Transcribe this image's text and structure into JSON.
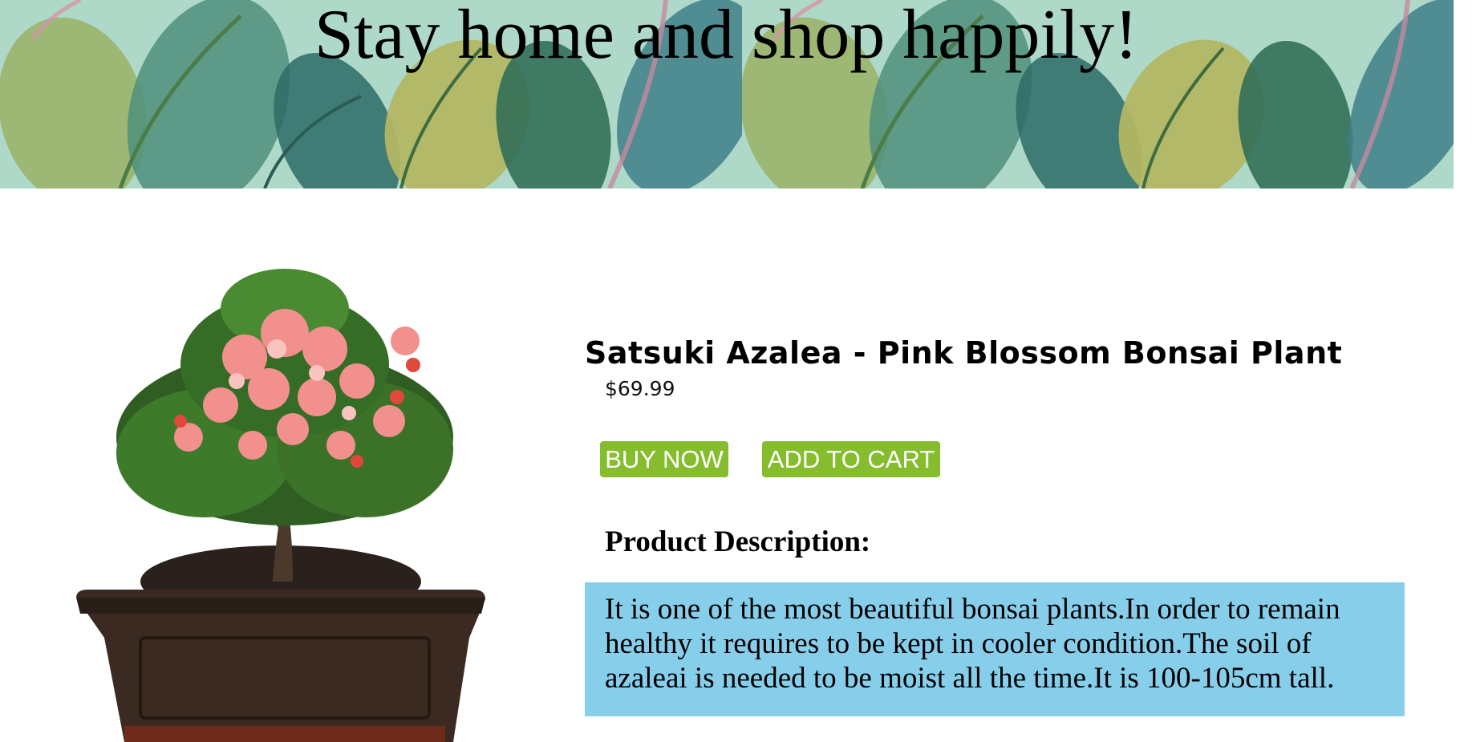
{
  "banner": {
    "title": "Stay home and shop happily!"
  },
  "product": {
    "image_alt": "Satsuki Azalea bonsai plant in brown pot",
    "name": "Satsuki Azalea - Pink Blossom Bonsai Plant",
    "price": "$69.99"
  },
  "actions": {
    "buy_now": "BUY NOW",
    "add_to_cart": "ADD TO CART"
  },
  "description": {
    "heading": "Product Description:",
    "text": "It is one of the most beautiful bonsai plants.In order to remain healthy it requires to be kept in cooler condition.The soil of azaleai is needed to be moist all the time.It is 100-105cm tall."
  },
  "colors": {
    "button_bg": "#86bd2f",
    "button_text": "#ffffff",
    "description_bg": "#87ceeb"
  }
}
